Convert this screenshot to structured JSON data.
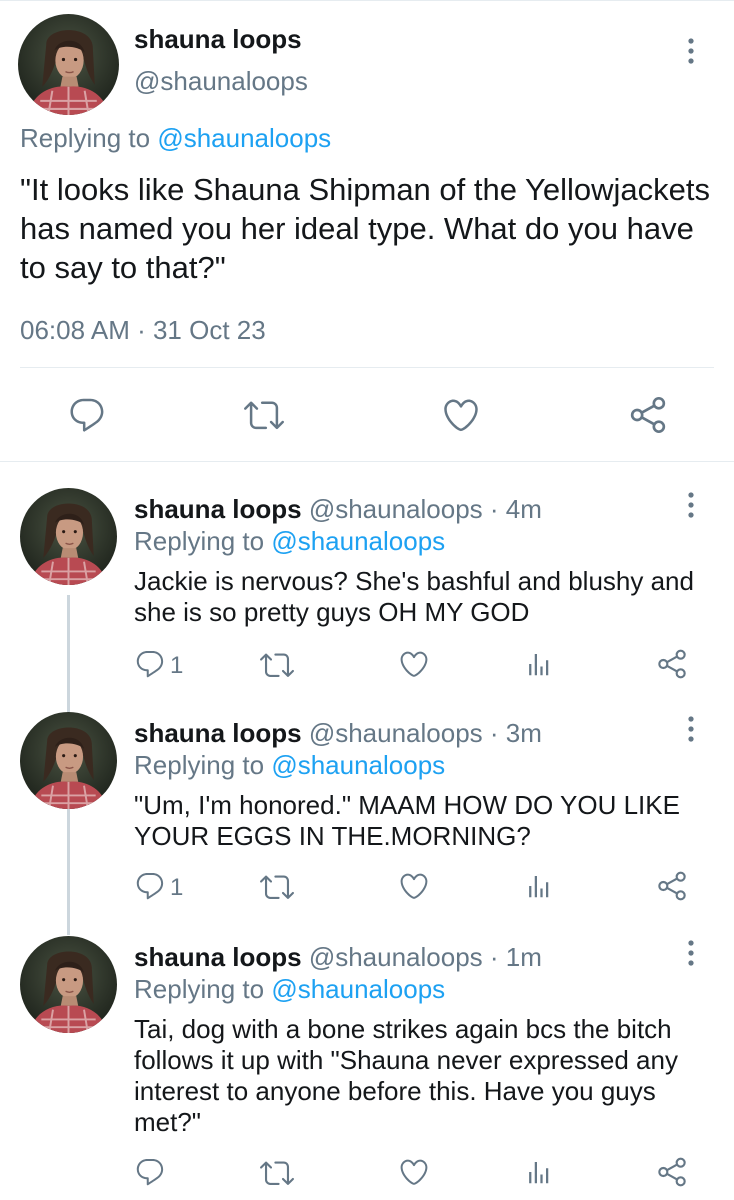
{
  "main_tweet": {
    "name": "shauna loops",
    "handle": "@shaunaloops",
    "replying_prefix": "Replying to",
    "replying_to": "@shaunaloops",
    "text": "\"It looks like Shauna Shipman of the Yellowjackets has named you her ideal type. What do you have to say to that?\"",
    "timestamp": "06:08 AM · 31 Oct 23",
    "icons": [
      "reply-icon",
      "retweet-icon",
      "like-icon",
      "share-icon",
      "more-icon"
    ]
  },
  "replies": [
    {
      "name": "shauna loops",
      "handle": "@shaunaloops",
      "age": "· 4m",
      "replying_prefix": "Replying to",
      "replying_to": "@shaunaloops",
      "text": "Jackie is nervous? She's bashful and blushy and she is so pretty guys OH MY GOD",
      "reply_count": "1"
    },
    {
      "name": "shauna loops",
      "handle": "@shaunaloops",
      "age": "· 3m",
      "replying_prefix": "Replying to",
      "replying_to": "@shaunaloops",
      "text": "\"Um, I'm honored.\" MAAM HOW DO YOU LIKE YOUR EGGS IN THE.MORNING?",
      "reply_count": "1"
    },
    {
      "name": "shauna loops",
      "handle": "@shaunaloops",
      "age": "· 1m",
      "replying_prefix": "Replying to",
      "replying_to": "@shaunaloops",
      "text": "Tai, dog with a bone strikes again bcs the bitch follows it up with \"Shauna never expressed any interest to anyone before this. Have you guys met?\"",
      "reply_count": ""
    }
  ],
  "colors": {
    "link": "#1da1f2",
    "secondary_text": "#657786",
    "primary_text": "#14171a",
    "divider": "#e6ecf0",
    "icon": "#657786"
  }
}
